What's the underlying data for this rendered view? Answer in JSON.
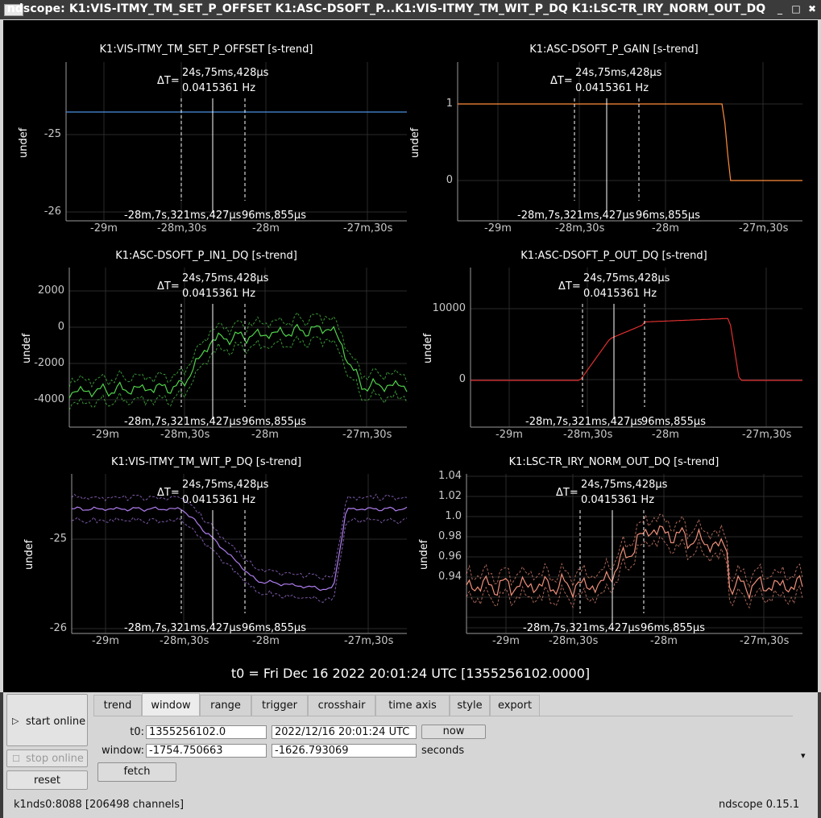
{
  "window": {
    "title": "ndscope: K1:VIS-ITMY_TM_SET_P_OFFSET K1:ASC-DSOFT_P...K1:VIS-ITMY_TM_WIT_P_DQ K1:LSC-TR_IRY_NORM_OUT_DQ",
    "minimize": "_",
    "maximize": "□",
    "close": "✖"
  },
  "plots": [
    {
      "title": "K1:VIS-ITMY_TM_SET_P_OFFSET [s-trend]",
      "ylabel": "undef",
      "yticks": [
        "-25",
        "-26"
      ]
    },
    {
      "title": "K1:ASC-DSOFT_P_GAIN [s-trend]",
      "ylabel": "undef",
      "yticks": [
        "1",
        "0"
      ]
    },
    {
      "title": "K1:ASC-DSOFT_P_IN1_DQ [s-trend]",
      "ylabel": "undef",
      "yticks": [
        "2000",
        "0",
        "-2000",
        "-4000"
      ]
    },
    {
      "title": "K1:ASC-DSOFT_P_OUT_DQ [s-trend]",
      "ylabel": "undef",
      "yticks": [
        "10000",
        "0"
      ]
    },
    {
      "title": "K1:VIS-ITMY_TM_WIT_P_DQ [s-trend]",
      "ylabel": "undef",
      "yticks": [
        "-25",
        "-26"
      ]
    },
    {
      "title": "K1:LSC-TR_IRY_NORM_OUT_DQ [s-trend]",
      "ylabel": "undef",
      "yticks": [
        "1.04",
        "1.02",
        "1.0",
        "0.98",
        "0.96",
        "0.94"
      ]
    }
  ],
  "xticks": [
    "-29m",
    "-28m,30s",
    "-28m",
    "-27m,30s"
  ],
  "cursor": {
    "delta_label": "ΔT=",
    "delta_time": "24s,75ms,428μs",
    "delta_freq": "0.0415361 Hz",
    "t1_label": "-28m,7s,321ms,427μs",
    "t2_label": "96ms,855μs"
  },
  "t0_display": "t0 = Fri Dec 16 2022 20:01:24 UTC [1355256102.0000]",
  "controls": {
    "start_online": "start online",
    "stop_online": "stop online",
    "reset": "reset",
    "tabs": [
      "trend",
      "window",
      "range",
      "trigger",
      "crosshair",
      "time axis",
      "style",
      "export"
    ],
    "active_tab": "window",
    "t0_label": "t0:",
    "t0_gps": "1355256102.0",
    "t0_utc": "2022/12/16 20:01:24 UTC",
    "now": "now",
    "window_label": "window:",
    "window_start": "-1754.750663",
    "window_end": "-1626.793069",
    "seconds": "seconds",
    "fetch": "fetch",
    "dropdown_arrow": "▾"
  },
  "status": {
    "server": "k1nds0:8088  [206498 channels]",
    "version": "ndscope 0.15.1"
  },
  "colors": {
    "series_1": "#4a8fe0",
    "series_2": "#ff8c3a",
    "series_3": "#4fd34a",
    "series_4": "#e03030",
    "series_5": "#b07ef0",
    "series_6": "#f0907a"
  }
}
